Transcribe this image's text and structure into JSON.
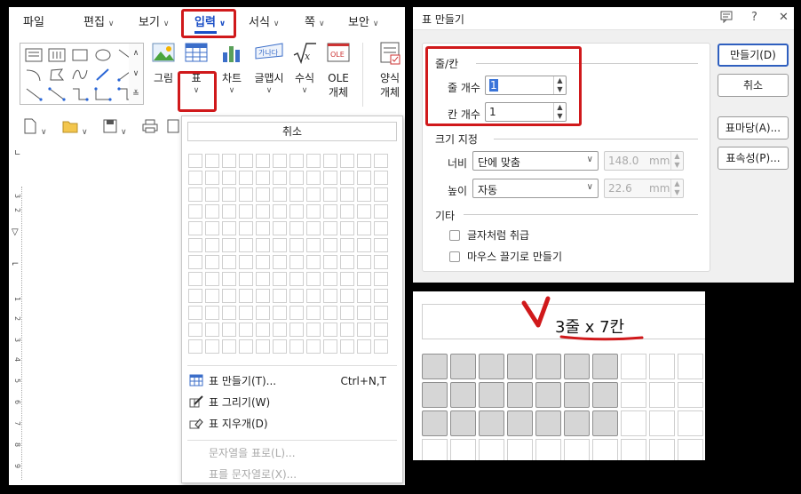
{
  "app": {
    "menus": [
      {
        "label": "파일",
        "chevron": false
      },
      {
        "label": "편집",
        "chevron": true
      },
      {
        "label": "보기",
        "chevron": true
      },
      {
        "label": "입력",
        "chevron": true,
        "active": true
      },
      {
        "label": "서식",
        "chevron": true
      },
      {
        "label": "쪽",
        "chevron": true
      },
      {
        "label": "보안",
        "chevron": true
      }
    ],
    "ribbon": {
      "picture_label": "그림",
      "table_label": "표",
      "chart_label": "차트",
      "wordart_label": "글맵시",
      "formula_label": "수식",
      "ole_label_1": "OLE",
      "ole_label_2": "개체",
      "form_label_1": "양식",
      "form_label_2": "개체"
    },
    "accent_color": "#1a4ec6",
    "highlight_color": "#d0191b",
    "ruler_numbers": [
      "3",
      "2",
      "1",
      "1",
      "2",
      "3",
      "4",
      "5",
      "6",
      "7",
      "8",
      "9"
    ]
  },
  "dropdown": {
    "cancel_label": "취소",
    "grid_cols": 12,
    "grid_rows": 12,
    "items": [
      {
        "label": "표 만들기(T)...",
        "shortcut": "Ctrl+N,T",
        "icon": "table-create-icon",
        "enabled": true
      },
      {
        "label": "표 그리기(W)",
        "shortcut": "",
        "icon": "table-draw-icon",
        "enabled": true
      },
      {
        "label": "표 지우개(D)",
        "shortcut": "",
        "icon": "eraser-icon",
        "enabled": true
      },
      {
        "label": "문자열을 표로(L)...",
        "shortcut": "",
        "icon": "",
        "enabled": false
      },
      {
        "label": "표를 문자열로(X)...",
        "shortcut": "",
        "icon": "",
        "enabled": false
      }
    ]
  },
  "dialog": {
    "title": "표 만들기",
    "help": "?",
    "close": "✕",
    "rows_cols": {
      "group": "줄/칸",
      "rows_label": "줄 개수",
      "rows_value": "1",
      "cols_label": "칸 개수",
      "cols_value": "1"
    },
    "size": {
      "group": "크기 지정",
      "width_label": "너비",
      "width_mode": "단에 맞춤",
      "width_value": "148.0",
      "height_label": "높이",
      "height_mode": "자동",
      "height_value": "22.6",
      "unit": "mm"
    },
    "other": {
      "group": "기타",
      "option1": "글자처럼 취급",
      "option2": "마우스 끌기로 만들기"
    },
    "buttons": {
      "create": "만들기(D)",
      "cancel": "취소",
      "table_style": "표마당(A)...",
      "table_props": "표속성(P)..."
    }
  },
  "zoom": {
    "label": "3줄 x 7칸",
    "selected_rows": 3,
    "selected_cols": 7,
    "mark_color": "#d0191b"
  }
}
